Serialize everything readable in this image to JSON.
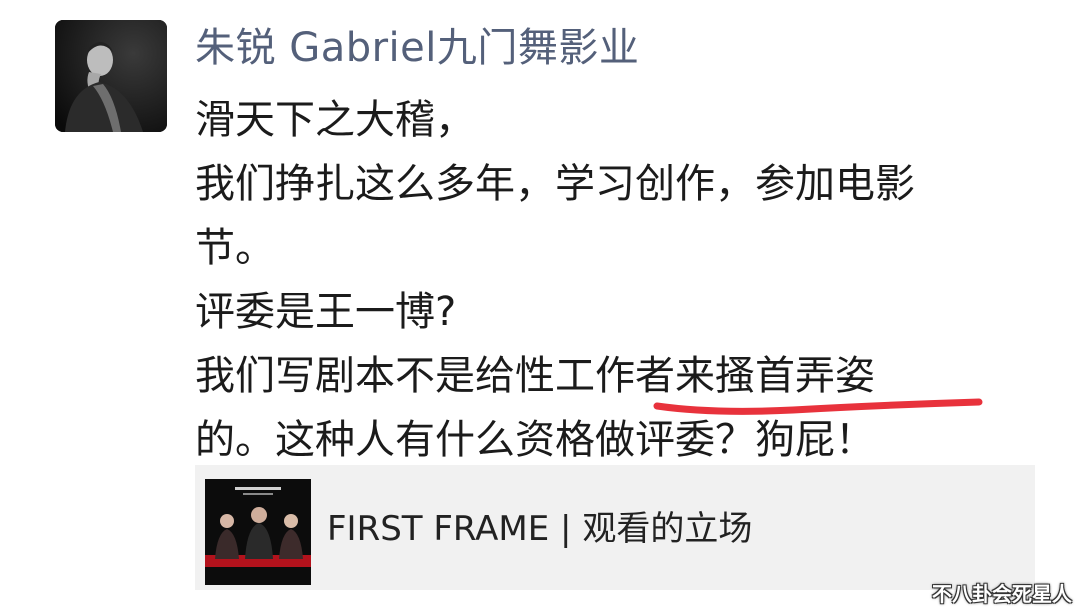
{
  "post": {
    "author": "朱锐 Gabriel九门舞影业",
    "lines": [
      "滑天下之大稽，",
      "我们挣扎这么多年，学习创作，参加电影",
      "节。",
      "评委是王一博?",
      "我们写剧本不是给性工作者来搔首弄姿",
      "的。这种人有什么资格做评委？狗屁！"
    ],
    "highlight_color": "#e8323c"
  },
  "link_card": {
    "title": "FIRST FRAME | 观看的立场",
    "thumbnail_icon": "film-poster-thumbnail"
  },
  "watermark": {
    "text": "不八卦会死星人"
  },
  "colors": {
    "author_name": "#54607a",
    "body_text": "#1b1b1b",
    "card_background": "#f1f1f1"
  }
}
